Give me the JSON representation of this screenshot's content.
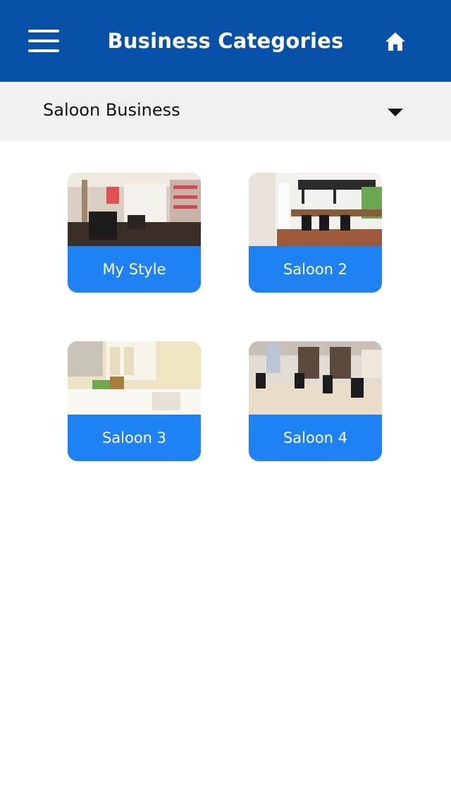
{
  "header": {
    "title": "Business Categories",
    "menu_icon": "hamburger-menu-icon",
    "home_icon": "home-icon",
    "bar_color": "#0751a8"
  },
  "category_select": {
    "selected": "Saloon Business",
    "caret_icon": "caret-down-icon"
  },
  "businesses": [
    {
      "name": "My Style",
      "image": "salon-interior-photo"
    },
    {
      "name": "Saloon 2",
      "image": "salon-interior-photo"
    },
    {
      "name": "Saloon 3",
      "image": "salon-interior-photo"
    },
    {
      "name": "Saloon 4",
      "image": "salon-interior-photo"
    }
  ],
  "colors": {
    "accent": "#1e82f5",
    "dropdown_bg": "#f0f0f0"
  }
}
